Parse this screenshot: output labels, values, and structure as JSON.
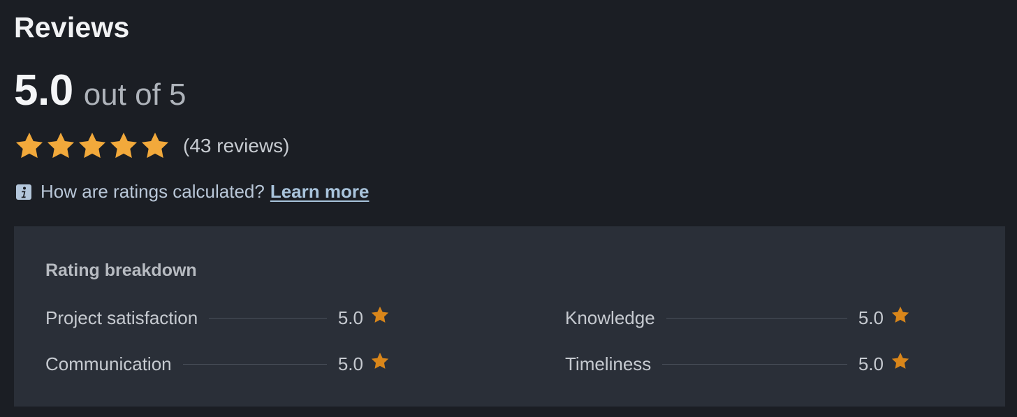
{
  "header": {
    "title": "Reviews"
  },
  "rating": {
    "value": "5.0",
    "suffix": "out of 5",
    "stars": 5,
    "star_color": "#f2a93b",
    "review_count": "(43 reviews)"
  },
  "info": {
    "icon": "info-icon",
    "text": "How are ratings calculated?",
    "link_label": "Learn more"
  },
  "breakdown": {
    "title": "Rating breakdown",
    "star_color": "#d9861a",
    "items": [
      {
        "label": "Project satisfaction",
        "value": "5.0"
      },
      {
        "label": "Communication",
        "value": "5.0"
      },
      {
        "label": "Knowledge",
        "value": "5.0"
      },
      {
        "label": "Timeliness",
        "value": "5.0"
      }
    ]
  },
  "colors": {
    "background": "#1b1e24",
    "panel": "#2a2f38",
    "link": "#a9c4dc"
  }
}
